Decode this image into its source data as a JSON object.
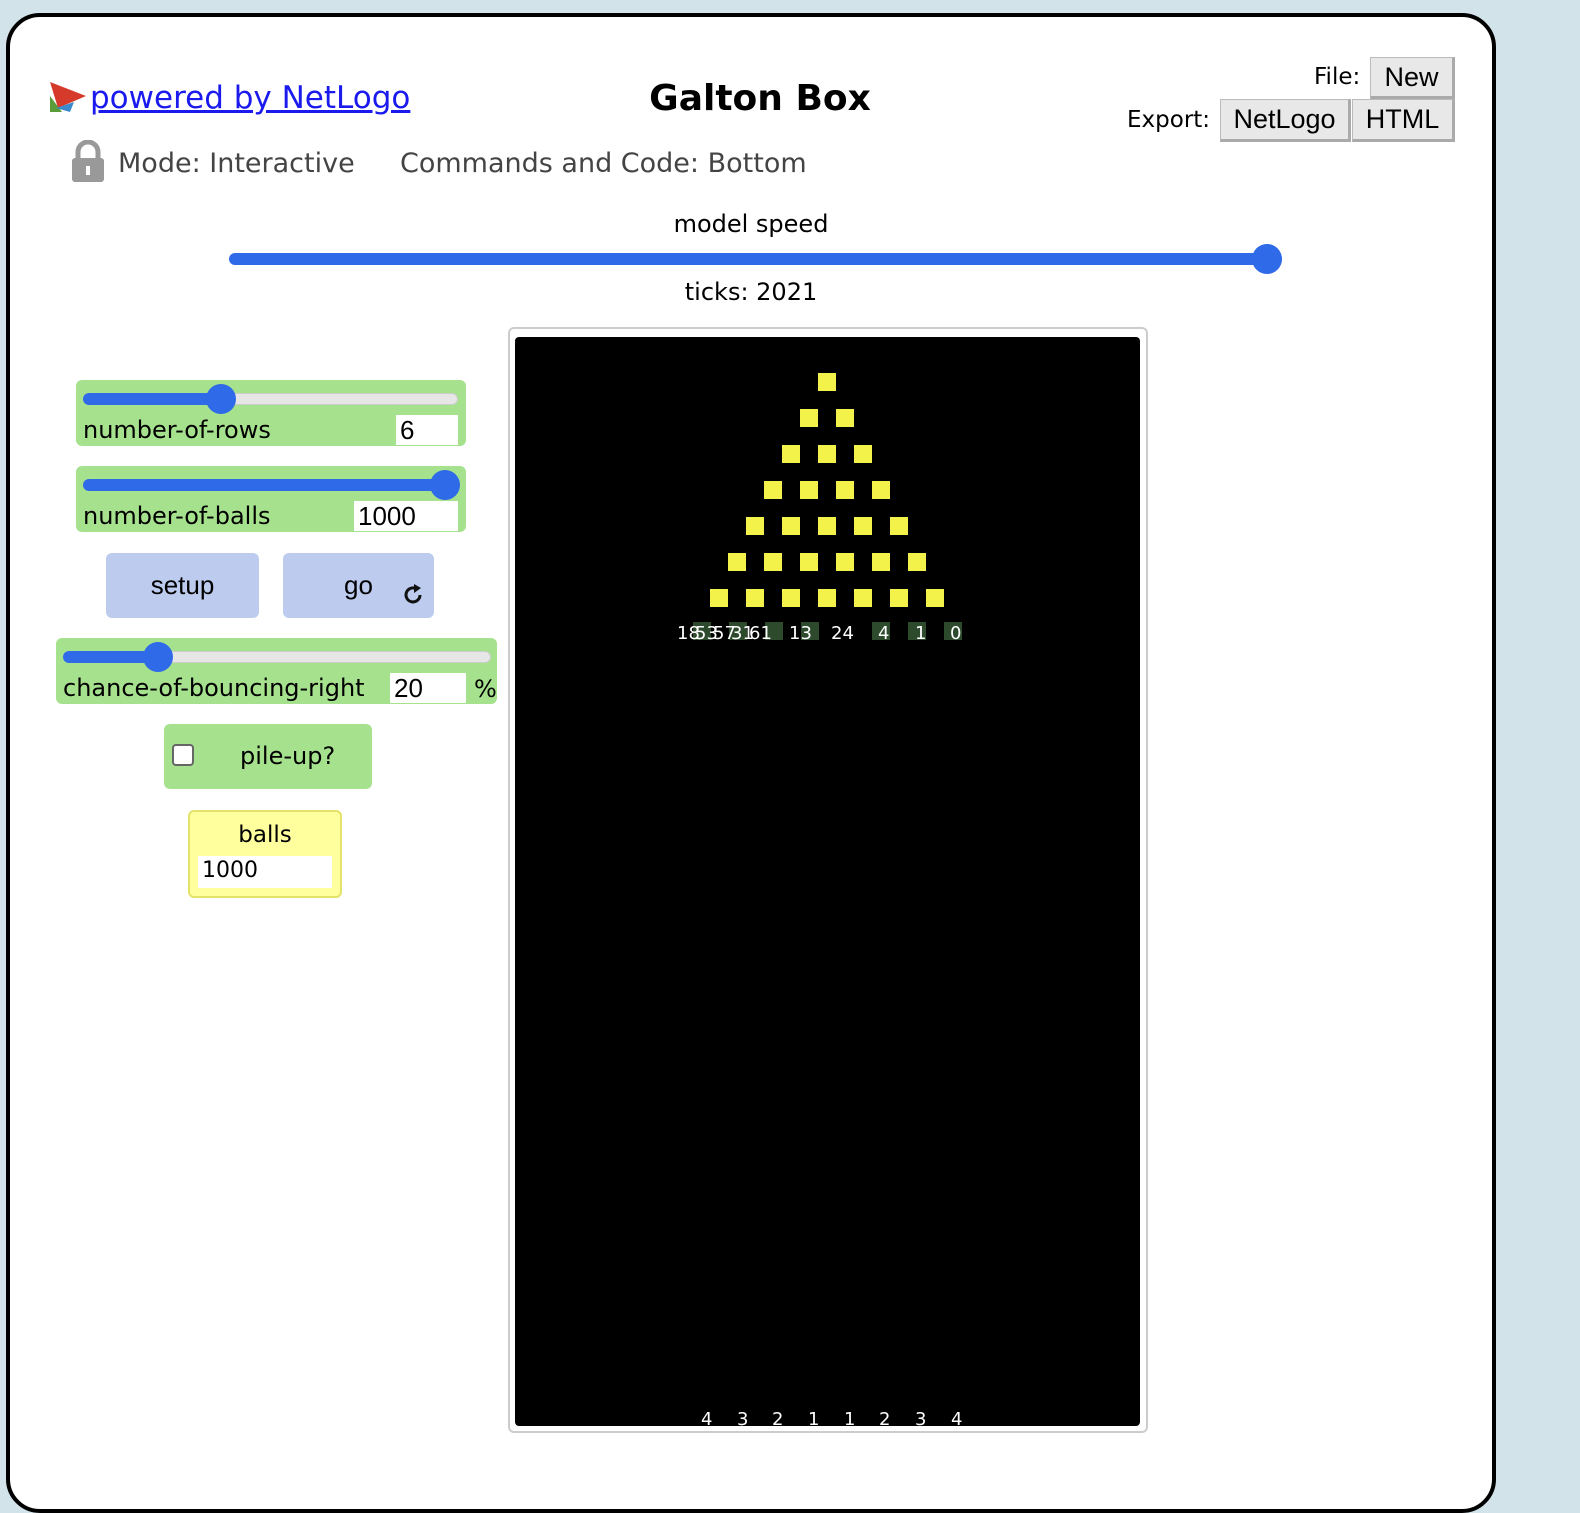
{
  "header": {
    "powered_by": "powered by NetLogo",
    "title": "Galton Box",
    "file_label": "File:",
    "file_new": "New",
    "export_label": "Export:",
    "export_netlogo": "NetLogo",
    "export_html": "HTML"
  },
  "mode_bar": {
    "mode": "Mode: Interactive",
    "commands": "Commands and Code: Bottom"
  },
  "speed": {
    "label": "model speed",
    "value_fraction": 1.0,
    "ticks": "ticks: 2021"
  },
  "widgets": {
    "rows_slider": {
      "label": "number-of-rows",
      "value": "6"
    },
    "balls_slider": {
      "label": "number-of-balls",
      "value": "1000"
    },
    "setup_button": "setup",
    "go_button": "go",
    "chance_slider": {
      "label": "chance-of-bouncing-right",
      "value": "20",
      "unit": "%"
    },
    "pile_switch": {
      "label": "pile-up?",
      "checked": false
    },
    "balls_monitor": {
      "label": "balls",
      "value": "1000"
    }
  },
  "world": {
    "peg_color": "#f2f24a",
    "background": "#000000",
    "top_counts": [
      "18",
      "53",
      "57",
      "31",
      "61",
      "13",
      "24",
      "4",
      "1",
      "0"
    ],
    "bottom_counts": [
      "4",
      "3",
      "2",
      "1",
      "1",
      "2",
      "3",
      "4"
    ]
  },
  "colors": {
    "accent": "#2f6ae8",
    "widget_green": "#a6e28d",
    "button_blue": "#bccbee",
    "monitor_yellow": "#ffff9e"
  }
}
